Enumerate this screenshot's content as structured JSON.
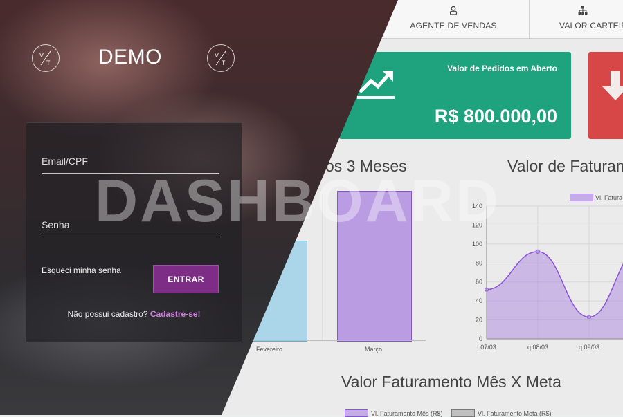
{
  "nav": {
    "items": [
      {
        "label": "AGENTE DE VENDAS",
        "icon": "user-icon"
      },
      {
        "label": "VALOR CARTEIRA C",
        "icon": "sitemap-icon"
      }
    ]
  },
  "cards": {
    "open_orders": {
      "title": "Valor de Pedidos em Aberto",
      "value": "R$ 800.000,00",
      "color": "#1fa37e",
      "icon": "trend-up-icon"
    },
    "second": {
      "color": "#d84747",
      "icon": "arrow-down-icon"
    }
  },
  "charts": {
    "bar_title": "os 3 Meses",
    "line_title": "Valor de Faturam",
    "bottom_title": "Valor Faturamento Mês X Meta",
    "line_legend": "Vl. Fatura",
    "bottom_legend": [
      "Vl. Faturamento Mês (R$)",
      "Vl. Faturamento Meta (R$)"
    ]
  },
  "chart_data": [
    {
      "type": "bar",
      "title": "os 3 Meses",
      "categories": [
        "Fevereiro",
        "Março"
      ],
      "values": [
        null,
        null
      ],
      "colors": [
        "#9fd3ea",
        "#b593e0"
      ]
    },
    {
      "type": "line",
      "title": "Valor de Faturam",
      "x": [
        "t:07/03",
        "q:08/03",
        "q:09/03"
      ],
      "series": [
        {
          "name": "Vl. Fatura",
          "values": [
            52,
            92,
            23
          ]
        }
      ],
      "yticks": [
        0,
        20,
        40,
        60,
        80,
        100,
        120,
        140
      ],
      "ylim": [
        0,
        140
      ],
      "grid": true,
      "legend": "top-right",
      "color": "#8a55d4"
    }
  ],
  "login": {
    "brand": "DEMO",
    "logo_text": [
      "V",
      "T"
    ],
    "email_placeholder": "Email/CPF",
    "password_placeholder": "Senha",
    "forgot": "Esqueci minha senha",
    "submit": "ENTRAR",
    "signup_text": "Não possui cadastro?",
    "signup_link": "Cadastre-se!"
  },
  "watermark": "DASHBOARD"
}
